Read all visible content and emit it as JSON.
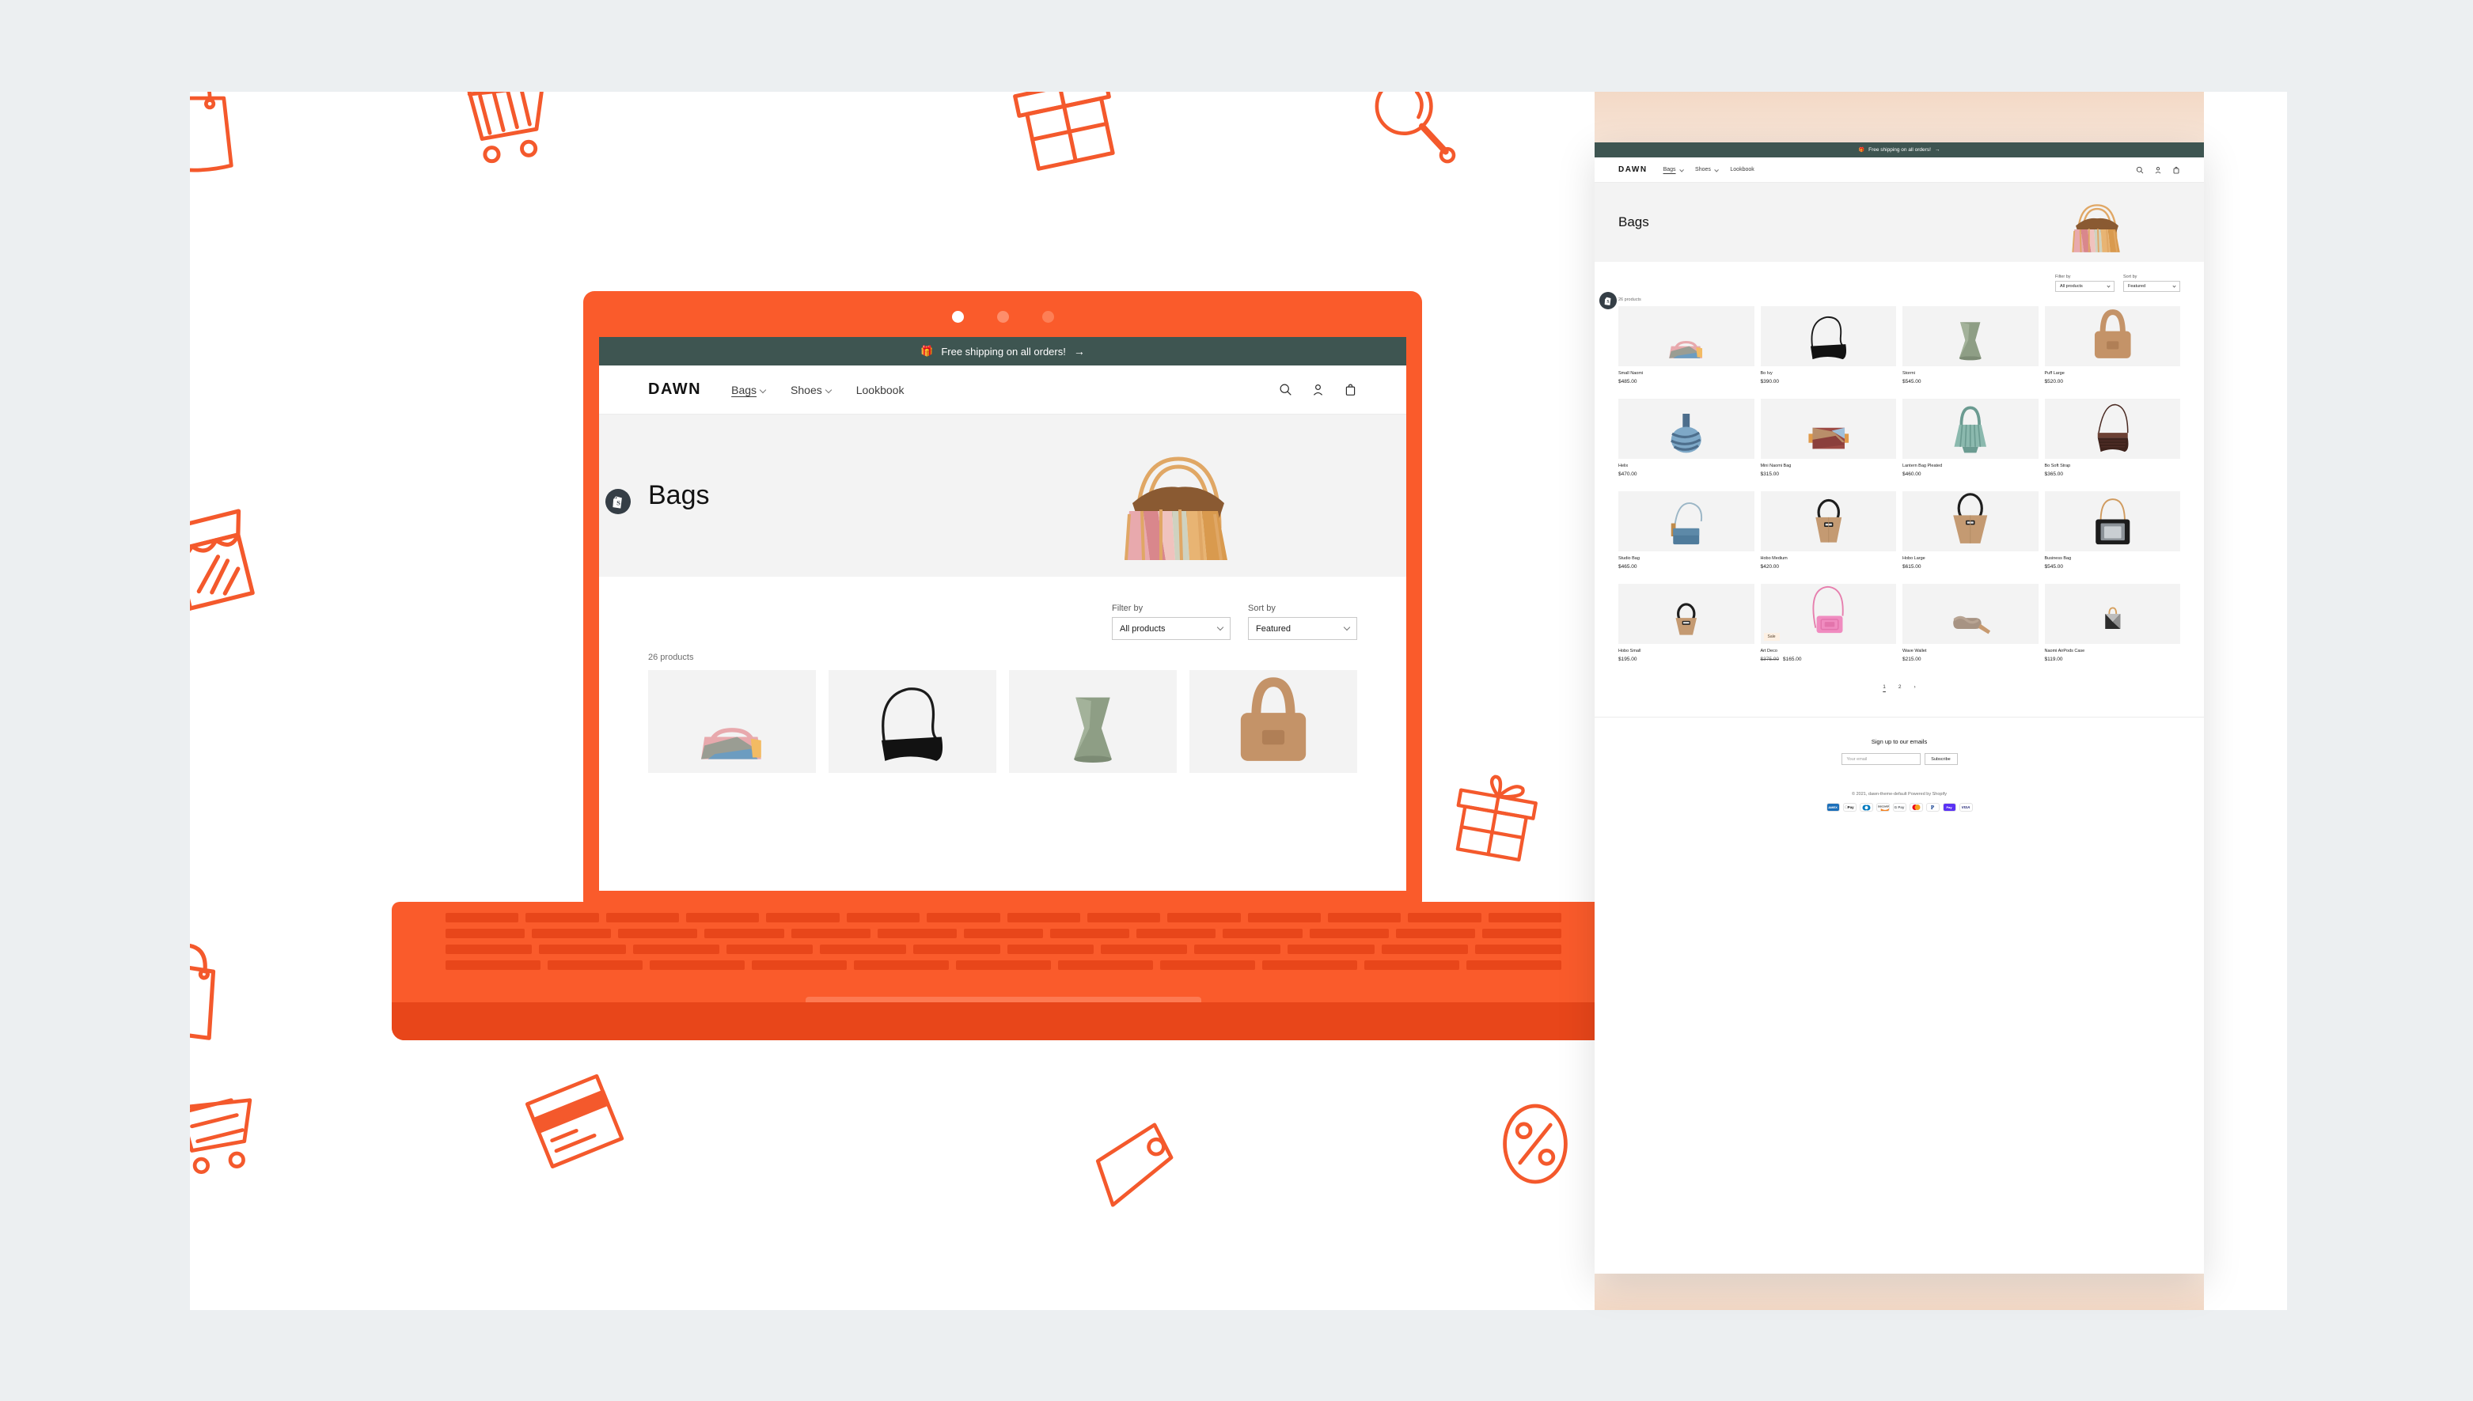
{
  "theme": {
    "accent_orange": "#fa5b2b",
    "announcement_green": "#3e5551",
    "page_bg": "#ffffff",
    "canvas_bg": "#eceff1"
  },
  "store": {
    "brand": "DAWN",
    "announcement": "Free shipping on all orders!",
    "announcement_icon": "gift-icon",
    "announcement_arrow": "→",
    "nav": [
      {
        "label": "Bags",
        "has_dropdown": true,
        "active": true
      },
      {
        "label": "Shoes",
        "has_dropdown": true,
        "active": false
      },
      {
        "label": "Lookbook",
        "has_dropdown": false,
        "active": false
      }
    ],
    "nav_icons": [
      "search-icon",
      "account-icon",
      "cart-icon"
    ]
  },
  "collection": {
    "title": "Bags",
    "filter_label": "Filter by",
    "filter_value": "All products",
    "sort_label": "Sort by",
    "sort_value": "Featured",
    "product_count": "26 products",
    "products": [
      {
        "title": "Small Naomi",
        "price": "$485.00"
      },
      {
        "title": "Bo Ivy",
        "price": "$390.00"
      },
      {
        "title": "Stormi",
        "price": "$545.00"
      },
      {
        "title": "Puff Large",
        "price": "$520.00"
      },
      {
        "title": "Helix",
        "price": "$470.00"
      },
      {
        "title": "Mini Naomi Bag",
        "price": "$315.00"
      },
      {
        "title": "Lantern Bag Pleated",
        "price": "$460.00"
      },
      {
        "title": "Bo Soft Strap",
        "price": "$365.00"
      },
      {
        "title": "Studio Bag",
        "price": "$465.00"
      },
      {
        "title": "Hobo Medium",
        "price": "$420.00"
      },
      {
        "title": "Hobo Large",
        "price": "$615.00"
      },
      {
        "title": "Business Bag",
        "price": "$545.00"
      },
      {
        "title": "Hobo Small",
        "price": "$195.00"
      },
      {
        "title": "Art Deco",
        "price": "$165.00",
        "compare_price": "$375.00",
        "badge": "Sale"
      },
      {
        "title": "Wave Wallet",
        "price": "$215.00"
      },
      {
        "title": "Naomi AirPods Case",
        "price": "$119.00"
      }
    ],
    "pagination": {
      "pages": [
        "1",
        "2"
      ],
      "current": "1",
      "next_arrow": "›"
    }
  },
  "footer": {
    "newsletter_heading": "Sign up to our emails",
    "email_placeholder": "Your email",
    "subscribe_label": "Subscribe",
    "copyright": "© 2021, dawn-theme-default Powered by Shopify",
    "payment_icons": [
      "amex",
      "apple-pay",
      "diners-club",
      "discover",
      "google-pay",
      "mastercard",
      "paypal",
      "shop-pay",
      "visa"
    ]
  },
  "laptop": {
    "carousel_dots": [
      "active",
      "inactive",
      "inactive"
    ],
    "badge_icon": "shopify-bag-icon"
  },
  "doodles": [
    "shopping-bag-icon",
    "shopping-cart-icon",
    "gift-box-icon",
    "magnifier-icon",
    "keyboard-icon",
    "storefront-icon",
    "tote-bag-icon",
    "gift-box-icon",
    "shopping-cart-icon",
    "credit-card-icon",
    "price-tag-icon",
    "percent-icon"
  ]
}
